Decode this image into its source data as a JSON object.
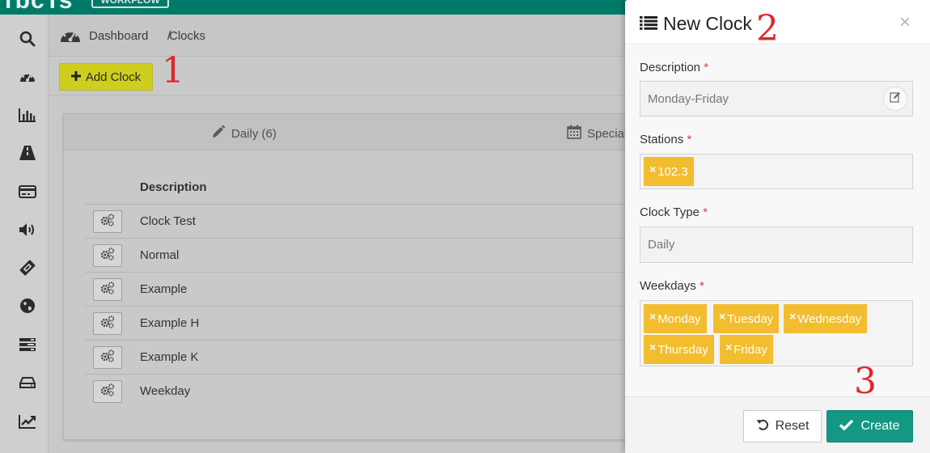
{
  "app": {
    "logo": "rbcTs",
    "badge": "WORKFLOW"
  },
  "breadcrumb": {
    "home": "Dashboard",
    "separator": "/",
    "current": "Clocks"
  },
  "toolbar": {
    "add_label": "Add Clock"
  },
  "tabs": [
    {
      "label": "Daily (6)",
      "icon": "pencil-icon"
    },
    {
      "label": "Special",
      "icon": "calendar-icon"
    }
  ],
  "table": {
    "header": "Description",
    "rows": [
      "Clock Test",
      "Normal",
      "Example",
      "Example H",
      "Example K",
      "Weekday"
    ]
  },
  "annotations": [
    "1",
    "2",
    "3"
  ],
  "modal": {
    "title": "New Clock",
    "close": "×",
    "fields": {
      "description": {
        "label": "Description",
        "value": "Monday-Friday"
      },
      "stations": {
        "label": "Stations",
        "chips": [
          "102.3"
        ]
      },
      "clock_type": {
        "label": "Clock Type",
        "value": "Daily"
      },
      "weekdays": {
        "label": "Weekdays",
        "chips": [
          "Monday",
          "Tuesday",
          "Wednesday",
          "Thursday",
          "Friday"
        ]
      }
    },
    "required_mark": "*",
    "chip_remove": "×",
    "reset_label": "Reset",
    "create_label": "Create"
  },
  "colors": {
    "brand": "#007a68",
    "highlight": "#cece1e",
    "chip": "#f2bd2e",
    "primary_button": "#139883",
    "annotation": "#e0262e"
  },
  "sidebar_icons": [
    "search-icon",
    "dashboard-icon",
    "bar-chart-icon",
    "road-icon",
    "credit-card-icon",
    "volume-icon",
    "ticket-icon",
    "globe-icon",
    "server-icon",
    "hdd-icon",
    "line-chart-icon"
  ]
}
